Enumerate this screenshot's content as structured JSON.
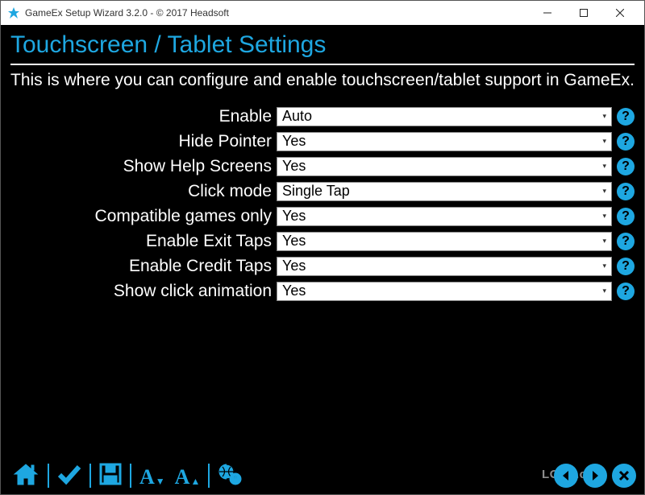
{
  "window": {
    "title": "GameEx Setup Wizard 3.2.0 - © 2017 Headsoft"
  },
  "page": {
    "heading": "Touchscreen / Tablet Settings",
    "description": "This is where you can configure and enable touchscreen/tablet support in GameEx."
  },
  "fields": [
    {
      "label": "Enable",
      "value": "Auto"
    },
    {
      "label": "Hide Pointer",
      "value": "Yes"
    },
    {
      "label": "Show Help Screens",
      "value": "Yes"
    },
    {
      "label": "Click mode",
      "value": "Single Tap"
    },
    {
      "label": "Compatible games only",
      "value": "Yes"
    },
    {
      "label": "Enable Exit Taps",
      "value": "Yes"
    },
    {
      "label": "Enable Credit Taps",
      "value": "Yes"
    },
    {
      "label": "Show click animation",
      "value": "Yes"
    }
  ],
  "help_glyph": "?",
  "watermark": "LO4D.com",
  "colors": {
    "accent": "#1ea7e1",
    "bg": "#000000",
    "fg": "#ffffff"
  }
}
